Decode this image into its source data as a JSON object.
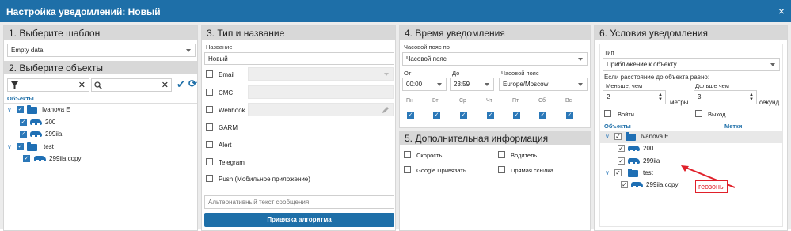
{
  "window": {
    "title": "Настройка уведомлений: Новый",
    "close": "×"
  },
  "p1": {
    "head1": "1. Выберите шаблон",
    "template": "Empty data",
    "head2": "2. Выберите объекты",
    "col": "Объекты",
    "tree": [
      {
        "label": "Ivanova E",
        "type": "folder"
      },
      {
        "label": "200",
        "type": "car"
      },
      {
        "label": "299iia",
        "type": "car"
      },
      {
        "label": "test",
        "type": "folder"
      },
      {
        "label": "299iia copy",
        "type": "car"
      }
    ]
  },
  "p3": {
    "head": "3. Тип и название",
    "name_label": "Название",
    "name_value": "Новый",
    "types": [
      "Email",
      "СМС",
      "Webhook",
      "GARM",
      "Alert",
      "Telegram",
      "Push (Мобильное приложение)"
    ],
    "alt_placeholder": "Альтернативный текст сообщения",
    "button": "Привязка алгоритма"
  },
  "p4": {
    "head": "4. Время уведомления",
    "tz_label": "Часовой пояс по",
    "tz_value": "Часовой пояс",
    "from_label": "От",
    "from_value": "00:00",
    "to_label": "До",
    "to_value": "23:59",
    "zone_label": "Часовой пояс",
    "zone_value": "Europe/Moscow",
    "days": [
      "Пн",
      "Вт",
      "Ср",
      "Чт",
      "Пт",
      "Сб",
      "Вс"
    ]
  },
  "p5": {
    "head": "5. Дополнительная информация",
    "items": [
      "Скорость",
      "Водитель",
      "Google Привязать",
      "Прямая ссылка"
    ]
  },
  "p6": {
    "head": "6. Условия уведомления",
    "type_label": "Тип",
    "type_value": "Приближение к объекту",
    "dist_label": "Если расстояние до объекта равно:",
    "less_label": "Меньше, чем",
    "less_value": "2",
    "meters": "метры",
    "more_label": "Дольше чем",
    "more_value": "3",
    "seconds": "секунд",
    "enter": "Войти",
    "exit": "Выход",
    "col_objects": "Объекты",
    "col_tags": "Метки",
    "tree": [
      {
        "label": "Ivanova E",
        "type": "folder"
      },
      {
        "label": "200",
        "type": "car"
      },
      {
        "label": "299iia",
        "type": "car"
      },
      {
        "label": "test",
        "type": "folder"
      },
      {
        "label": "299iia copy",
        "type": "car"
      }
    ],
    "annotation": "геозоны"
  },
  "accent": "#1e6fa8",
  "annotation_color": "#e0202a"
}
